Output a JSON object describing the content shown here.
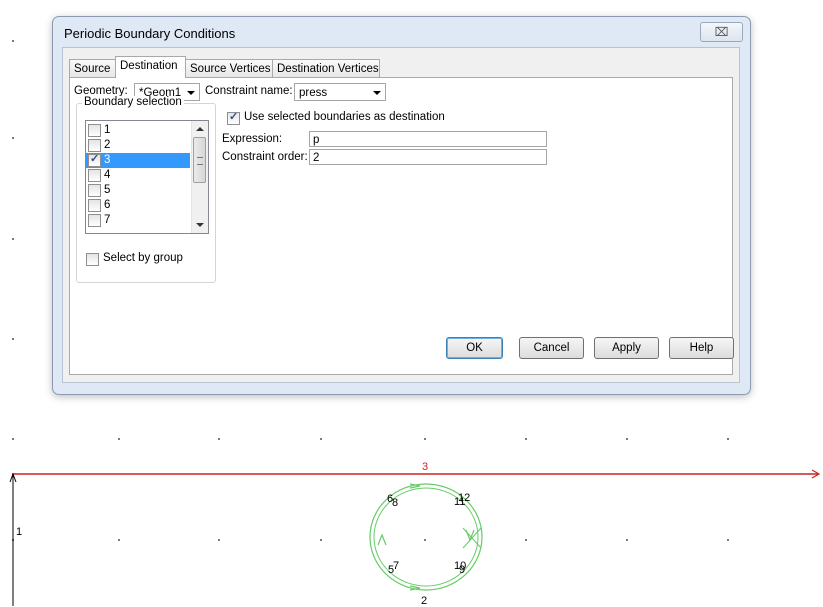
{
  "dialog": {
    "title": "Periodic Boundary Conditions",
    "close_label": "⌧",
    "tabs": [
      "Source",
      "Destination",
      "Source Vertices",
      "Destination Vertices"
    ],
    "active_tab": "Destination",
    "geometry_label": "Geometry:",
    "geometry_value": "*Geom1",
    "constraint_name_label": "Constraint name:",
    "constraint_name_value": "press",
    "boundary_selection_title": "Boundary selection",
    "boundaries": [
      {
        "label": "1",
        "checked": false,
        "selected": false
      },
      {
        "label": "2",
        "checked": false,
        "selected": false
      },
      {
        "label": "3",
        "checked": true,
        "selected": true
      },
      {
        "label": "4",
        "checked": false,
        "selected": false
      },
      {
        "label": "5",
        "checked": false,
        "selected": false
      },
      {
        "label": "6",
        "checked": false,
        "selected": false
      },
      {
        "label": "7",
        "checked": false,
        "selected": false
      }
    ],
    "select_by_group_label": "Select by group",
    "select_by_group_checked": false,
    "use_selected_label": "Use selected boundaries as destination",
    "use_selected_checked": true,
    "expression_label": "Expression:",
    "expression_value": "p",
    "constraint_order_label": "Constraint order:",
    "constraint_order_value": "2",
    "buttons": {
      "ok": "OK",
      "cancel": "Cancel",
      "apply": "Apply",
      "help": "Help"
    }
  },
  "geometry_view": {
    "boundary_labels": {
      "top": "3",
      "left": "1",
      "circle_bottom": "2"
    },
    "vertex_labels": [
      "6",
      "8",
      "11",
      "12",
      "5",
      "7",
      "10",
      "9"
    ],
    "colors": {
      "selected_boundary": "#cc2222",
      "circle": "#66cc66",
      "axis": "#000000"
    }
  }
}
